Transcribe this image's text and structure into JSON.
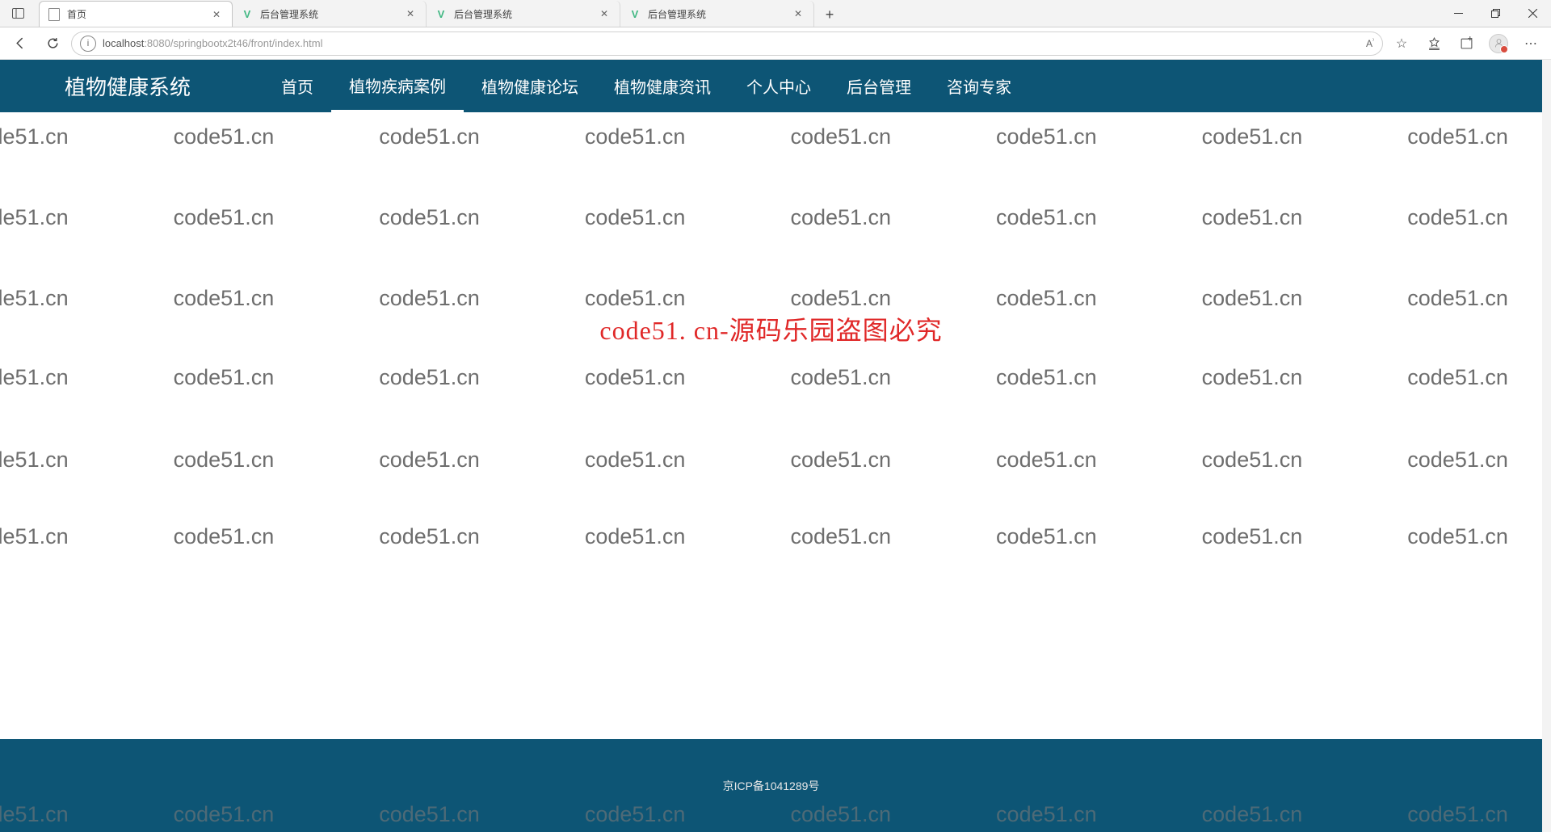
{
  "browser": {
    "tabs": [
      {
        "title": "首页",
        "icon": "page",
        "active": true
      },
      {
        "title": "后台管理系统",
        "icon": "vue",
        "active": false
      },
      {
        "title": "后台管理系统",
        "icon": "vue",
        "active": false
      },
      {
        "title": "后台管理系统",
        "icon": "vue",
        "active": false
      }
    ],
    "url_host": "localhost",
    "url_path": ":8080/springbootx2t46/front/index.html"
  },
  "site": {
    "brand": "植物健康系统",
    "nav": [
      "首页",
      "植物疾病案例",
      "植物健康论坛",
      "植物健康资讯",
      "个人中心",
      "后台管理",
      "咨询专家"
    ],
    "nav_active_index": 1,
    "footer": "京ICP备1041289号"
  },
  "watermark": {
    "tile": "code51.cn",
    "center": "code51. cn-源码乐园盗图必究"
  }
}
